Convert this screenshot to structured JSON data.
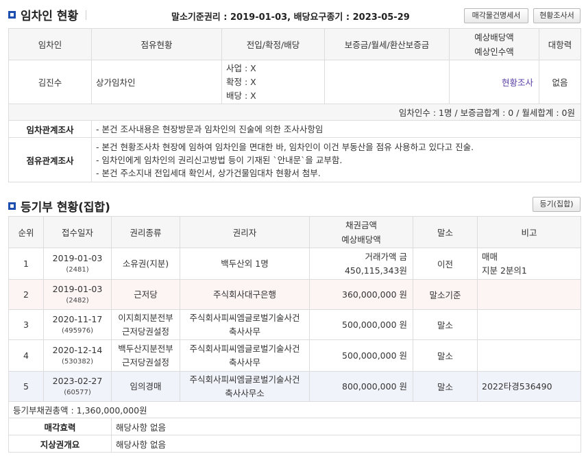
{
  "tenant_section": {
    "title": "임차인 현황",
    "rights_summary": "말소기준권리 : 2019-01-03, 배당요구종기 : 2023-05-29",
    "buttons": [
      "매각물건명세서",
      "현황조사서"
    ],
    "headers": {
      "tenant": "임차인",
      "occupancy": "점유현황",
      "move_in": "전입/확정/배당",
      "deposit": "보증금/월세/환산보증금",
      "expected_1": "예상배당액",
      "expected_2": "예상인수액",
      "opposing": "대항력"
    },
    "rows": [
      {
        "tenant": "김진수",
        "occupancy": "상가임차인",
        "move_in_lines": [
          "사업 : X",
          "확정 : X",
          "배당 : X"
        ],
        "deposit": "",
        "expected_link": "현황조사",
        "opposing": "없음"
      }
    ],
    "summary": "임차인수 : 1명 / 보증금합계 : 0 / 월세합계 : 0원",
    "lease_check": {
      "label": "임차관계조사",
      "lines": [
        "- 본건 조사내용은 현장방문과 임차인의 진술에 의한 조사사항임"
      ]
    },
    "occupancy_check": {
      "label": "점유관계조사",
      "lines": [
        "- 본건 현황조사차 현장에 임하여 임차인을 면대한 바, 임차인이 이건 부동산을 점유 사용하고 있다고 진술.",
        "- 임차인에게 임차인의 권리신고방법 등이 기재된 `안내문`을 교부함.",
        "- 본건 주소지내 전입세대 확인서, 상가건물임대차 현황서 첨부."
      ]
    }
  },
  "registry_section": {
    "title": "등기부 현황(집합)",
    "button": "등기(집합)",
    "headers": {
      "rank": "순위",
      "date": "접수일자",
      "type": "권리종류",
      "holder": "권리자",
      "amount_1": "채권금액",
      "amount_2": "예상배당액",
      "cancel": "말소",
      "note": "비고"
    },
    "rows": [
      {
        "rank": "1",
        "date": "2019-01-03",
        "receipt": "(2481)",
        "type_lines": [
          "소유권(지분)"
        ],
        "holder_lines": [
          "백두산외 1명"
        ],
        "amount": "거래가액 금450,115,343원",
        "cancel": "이전",
        "note_lines": [
          "매매",
          "지분 2분의1"
        ],
        "style": "normal"
      },
      {
        "rank": "2",
        "date": "2019-01-03",
        "receipt": "(2482)",
        "type_lines": [
          "근저당"
        ],
        "holder_lines": [
          "주식회사대구은행"
        ],
        "amount": "360,000,000 원",
        "cancel": "말소기준",
        "note_lines": [],
        "style": "pink"
      },
      {
        "rank": "3",
        "date": "2020-11-17",
        "receipt": "(495976)",
        "type_lines": [
          "이지희지분전부",
          "근저당권설정"
        ],
        "holder_lines": [
          "주식회사피씨엠글로벌기술사건",
          "축사사무"
        ],
        "amount": "500,000,000 원",
        "cancel": "말소",
        "note_lines": [],
        "style": "normal"
      },
      {
        "rank": "4",
        "date": "2020-12-14",
        "receipt": "(530382)",
        "type_lines": [
          "백두산지분전부",
          "근저당권설정"
        ],
        "holder_lines": [
          "주식회사피씨엠글로벌기술사건",
          "축사사무"
        ],
        "amount": "500,000,000 원",
        "cancel": "말소",
        "note_lines": [],
        "style": "normal"
      },
      {
        "rank": "5",
        "date": "2023-02-27",
        "receipt": "(60577)",
        "type_lines": [
          "임의경매"
        ],
        "holder_lines": [
          "주식회사피씨엠글로벌기술사건",
          "축사사무소"
        ],
        "amount": "800,000,000 원",
        "cancel": "말소",
        "note_lines": [
          "2022타경536490"
        ],
        "style": "blue"
      }
    ],
    "total": "등기부채권총액 : 1,360,000,000원",
    "sale_effect": {
      "label": "매각효력",
      "value": "해당사항 없음"
    },
    "surface_right": {
      "label": "지상권개요",
      "value": "해당사항 없음"
    }
  }
}
